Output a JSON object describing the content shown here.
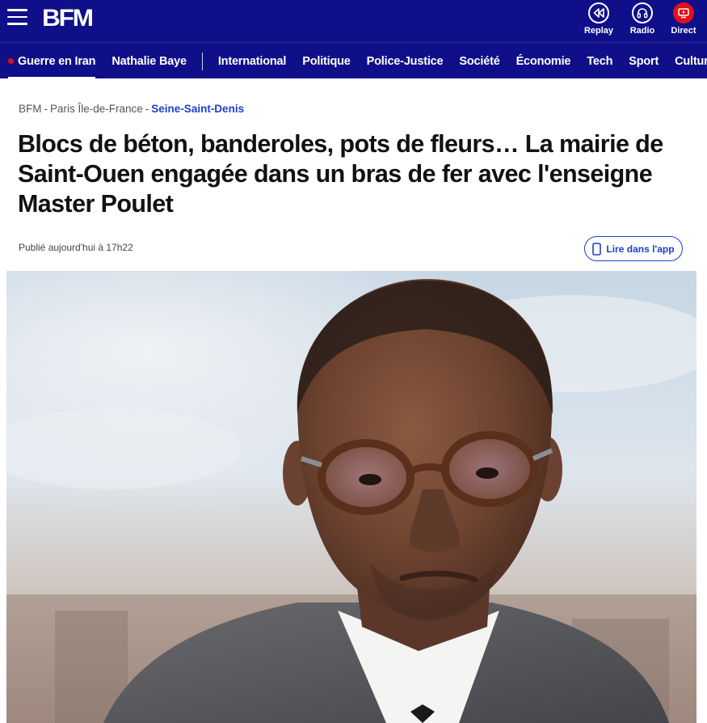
{
  "header": {
    "logo": "BFM",
    "buttons": [
      {
        "label": "Replay",
        "icon": "rewind-icon"
      },
      {
        "label": "Radio",
        "icon": "headphones-icon"
      },
      {
        "label": "Direct",
        "icon": "live-tv-icon"
      }
    ],
    "colors": {
      "background": "#0f0f8a",
      "live": "#e1101a",
      "link": "#1b3ed1"
    }
  },
  "nav": {
    "items": [
      {
        "label": "Guerre en Iran",
        "live": true
      },
      {
        "label": "Nathalie Baye"
      },
      {
        "label": "International"
      },
      {
        "label": "Politique"
      },
      {
        "label": "Police-Justice"
      },
      {
        "label": "Société"
      },
      {
        "label": "Économie"
      },
      {
        "label": "Tech"
      },
      {
        "label": "Sport"
      },
      {
        "label": "Culture"
      }
    ]
  },
  "article": {
    "breadcrumb": [
      "BFM",
      "Paris Île-de-France",
      "Seine-Saint-Denis"
    ],
    "breadcrumb_separator": "-",
    "title": "Blocs de béton, banderoles, pots de fleurs… La mairie de Saint-Ouen engagée dans un bras de fer avec l'enseigne Master Poulet",
    "published": "Publié aujourd'hui à 17h22",
    "app_button": "Lire dans l'app",
    "image_alt": "hero-photo-man-with-glasses"
  }
}
